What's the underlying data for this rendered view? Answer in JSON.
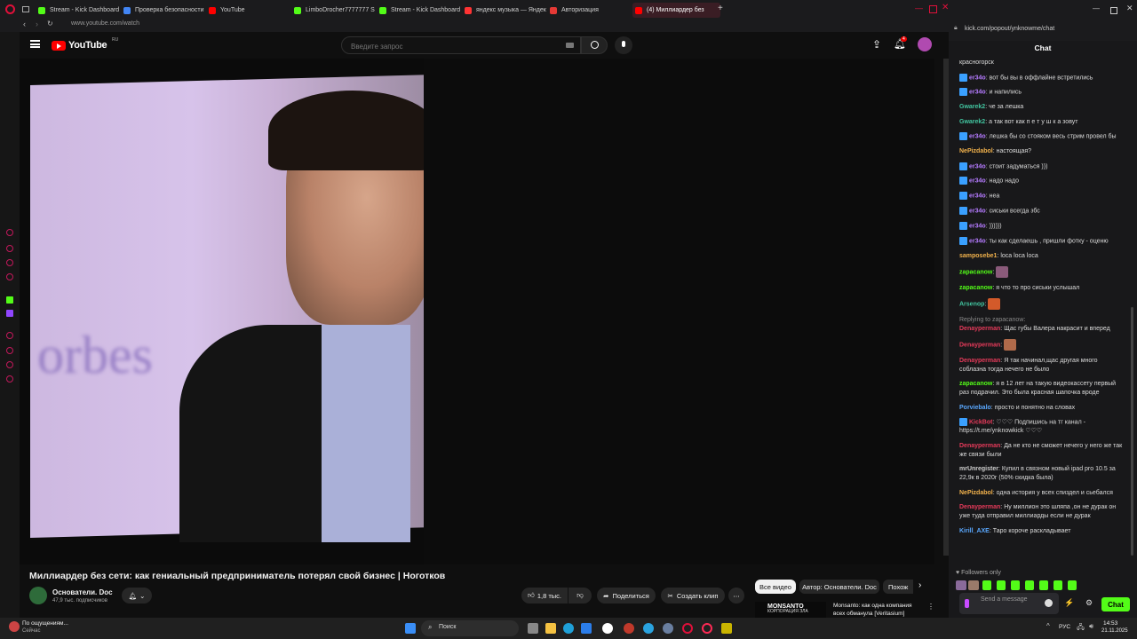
{
  "browser": {
    "tabs": [
      {
        "label": "Stream - Kick Dashboard",
        "color": "#53fc18"
      },
      {
        "label": "Проверка безопасности",
        "color": "#4285f4"
      },
      {
        "label": "YouTube",
        "color": "#ff0000"
      },
      {
        "label": "LimboDrocher7777777 S",
        "color": "#53fc18"
      },
      {
        "label": "Stream - Kick Dashboard",
        "color": "#53fc18"
      },
      {
        "label": "яндекс музыка — Яндекс",
        "color": "#ff3333"
      },
      {
        "label": "Авторизация",
        "color": "#e53935"
      },
      {
        "label": "(4) Миллиардер без",
        "color": "#ff0000"
      }
    ],
    "url": "www.youtube.com/watch"
  },
  "youtube": {
    "logo_text": "YouTube",
    "logo_region": "RU",
    "search_placeholder": "Введите запрос",
    "notifications_count": "4",
    "video_title": "Миллиардер без сети: как гениальный предприниматель потерял свой бизнес | Ноготков",
    "channel_name": "Основатели. Doc",
    "subscribers": "47,9 тыс. подписчиков",
    "likes": "1,8 тыс.",
    "share_label": "Поделиться",
    "clip_label": "Создать клип",
    "chips": [
      "Все видео",
      "Автор: Основатели. Doc",
      "Похож"
    ],
    "rec_thumb_text": "MONSANTO",
    "rec_thumb_sub": "КОРПОРАЦИЯ ЗЛА",
    "rec_title": "Monsanto: как одна компания",
    "rec_title2": "всех обманула [Veritasium]"
  },
  "chat": {
    "url": "kick.com/popout/ynknowme/chat",
    "title": "Chat",
    "messages": [
      {
        "user": "",
        "text": "красногорск",
        "color": "#dcdcdc",
        "badge": false
      },
      {
        "user": "er34o",
        "text": "вот бы вы в оффлайне встретились",
        "color": "#b57bff",
        "badge": true
      },
      {
        "user": "er34o",
        "text": "и напились",
        "color": "#b57bff",
        "badge": true
      },
      {
        "user": "Gwarek2",
        "text": "че за лешка",
        "color": "#42c5a0",
        "badge": false
      },
      {
        "user": "Gwarek2",
        "text": "а так вот как п е т у ш к а зовут",
        "color": "#42c5a0",
        "badge": false
      },
      {
        "user": "er34o",
        "text": "лешка бы со стояком весь стрим провел бы",
        "color": "#b57bff",
        "badge": true
      },
      {
        "user": "NePizdabol",
        "text": "настоящая?",
        "color": "#f2b24c",
        "badge": false
      },
      {
        "user": "er34o",
        "text": "стоит задуматься )))",
        "color": "#b57bff",
        "badge": true
      },
      {
        "user": "er34o",
        "text": "надо надо",
        "color": "#b57bff",
        "badge": true
      },
      {
        "user": "er34o",
        "text": "неа",
        "color": "#b57bff",
        "badge": true
      },
      {
        "user": "er34o",
        "text": "сиськи всегда збс",
        "color": "#b57bff",
        "badge": true
      },
      {
        "user": "er34o",
        "text": "))))))",
        "color": "#b57bff",
        "badge": true
      },
      {
        "user": "er34o",
        "text": "ты как сделаешь , пришли фотку - оценю",
        "color": "#b57bff",
        "badge": true
      },
      {
        "user": "samposebe1",
        "text": "loca loca loca",
        "color": "#f2b24c",
        "badge": false
      },
      {
        "user": "zapacanow",
        "text": "",
        "color": "#53fc18",
        "badge": false,
        "emote": "#8a5a7a"
      },
      {
        "user": "zapacanow",
        "text": "я что то про сиськи услышал",
        "color": "#53fc18",
        "badge": false
      },
      {
        "user": "Arsenop",
        "text": "",
        "color": "#42c5a0",
        "badge": false,
        "emote": "#d35a2a"
      },
      {
        "user": "Denayperman",
        "text": "Щас губы Валера накрасит и вперед",
        "color": "#e53a5a",
        "badge": false,
        "reply": "Replying to zapacanow:"
      },
      {
        "user": "Denayperman",
        "text": "",
        "color": "#e53a5a",
        "badge": false,
        "emote": "#b06a4a"
      },
      {
        "user": "Denayperman",
        "text": "Я так начинал,щас другая много соблазна тогда нечего не было",
        "color": "#e53a5a",
        "badge": false
      },
      {
        "user": "zapacanow",
        "text": "я в 12 лет на такую видеокассету первый раз подрачил. Это была красная шапочка вроде",
        "color": "#53fc18",
        "badge": false
      },
      {
        "user": "Porviebalo",
        "text": "просто и понятно на словах",
        "color": "#5aa8ff",
        "badge": false
      },
      {
        "user": "KickBot",
        "text": "♡♡♡ Подпишись на тг канал - https://t.me/ynknowkick ♡♡♡",
        "color": "#e53a5a",
        "badge": true
      },
      {
        "user": "Denayperman",
        "text": "Да не кто не сможет нечего у него же так же связи были",
        "color": "#e53a5a",
        "badge": false
      },
      {
        "user": "mrUnregister",
        "text": "Купил в связном новый ipad pro 10.5 за 22,9к в 2020г (50% скидка была)",
        "color": "#cfcfcf",
        "badge": false
      },
      {
        "user": "NePizdabol",
        "text": "одна история у всех спиздел и сьебался",
        "color": "#f2b24c",
        "badge": false
      },
      {
        "user": "Denayperman",
        "text": "Ну миллион это шляпа ,он не дурак он уже туда отправил миллиарды если не дурак",
        "color": "#e53a5a",
        "badge": false
      },
      {
        "user": "Kirill_AXE",
        "text": "Таро короче раскладывает",
        "color": "#5aa8ff",
        "badge": false
      }
    ],
    "followers_only": "Followers only",
    "send_placeholder": "Send a message",
    "chat_button": "Chat"
  },
  "taskbar": {
    "notification_title": "По ощущениям...",
    "notification_sub": "Сейчас",
    "search_label": "Поиск",
    "lang": "РУС",
    "time": "14:53",
    "date": "21.11.2025"
  }
}
